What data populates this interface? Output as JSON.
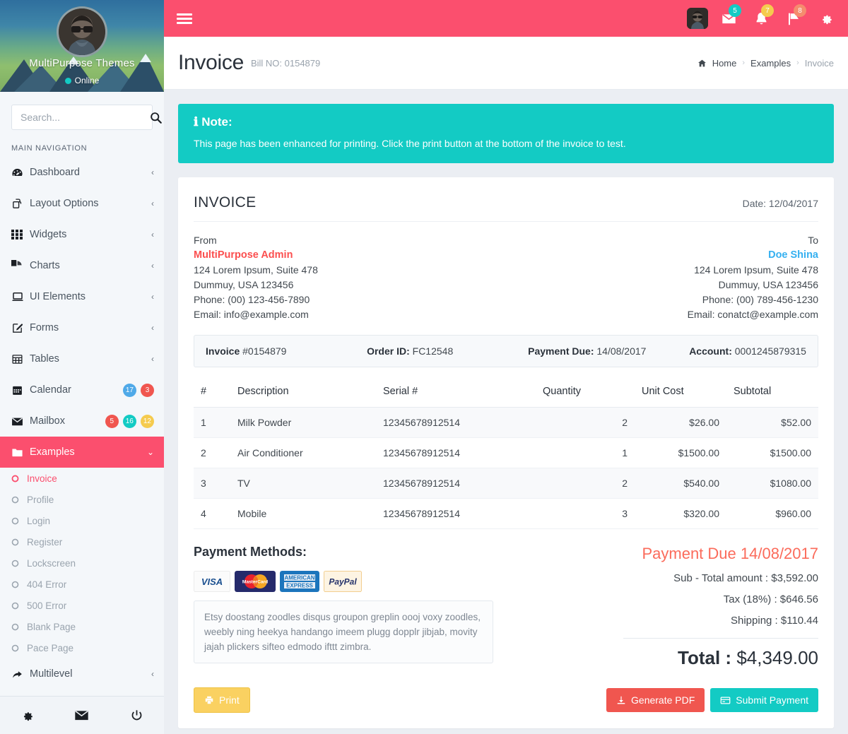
{
  "colors": {
    "brand_pink": "#fb4f6e",
    "teal": "#13cbc4",
    "yellow": "#fad161",
    "red": "#f0564f",
    "blue": "#35b0f0",
    "body_bg": "#ebeef3"
  },
  "sidebar": {
    "profile": {
      "name": "MultiPurpose Themes",
      "status": "Online",
      "avatar_icon": "user-avatar"
    },
    "search": {
      "placeholder": "Search...",
      "value": "",
      "icon": "search-icon"
    },
    "nav_title": "MAIN NAVIGATION",
    "items": [
      {
        "label": "Dashboard",
        "icon": "dashboard-icon",
        "caret": "‹",
        "badges": []
      },
      {
        "label": "Layout Options",
        "icon": "layers-icon",
        "caret": "‹",
        "badges": []
      },
      {
        "label": "Widgets",
        "icon": "grid-icon",
        "caret": "‹",
        "badges": []
      },
      {
        "label": "Charts",
        "icon": "pie-chart-icon",
        "caret": "‹",
        "badges": []
      },
      {
        "label": "UI Elements",
        "icon": "laptop-icon",
        "caret": "‹",
        "badges": []
      },
      {
        "label": "Forms",
        "icon": "edit-icon",
        "caret": "‹",
        "badges": []
      },
      {
        "label": "Tables",
        "icon": "table-icon",
        "caret": "‹",
        "badges": []
      },
      {
        "label": "Calendar",
        "icon": "calendar-icon",
        "caret": "",
        "badges": [
          {
            "text": "17",
            "color": "#4fa9e8"
          },
          {
            "text": "3",
            "color": "#f0564f"
          }
        ]
      },
      {
        "label": "Mailbox",
        "icon": "envelope-icon",
        "caret": "",
        "badges": [
          {
            "text": "5",
            "color": "#f0564f"
          },
          {
            "text": "16",
            "color": "#13cbc4"
          },
          {
            "text": "12",
            "color": "#f5cb4e"
          }
        ]
      }
    ],
    "examples": {
      "label": "Examples",
      "icon": "folder-icon",
      "caret": "⌄",
      "active": true,
      "children": [
        {
          "label": "Invoice",
          "active": true
        },
        {
          "label": "Profile",
          "active": false
        },
        {
          "label": "Login",
          "active": false
        },
        {
          "label": "Register",
          "active": false
        },
        {
          "label": "Lockscreen",
          "active": false
        },
        {
          "label": "404 Error",
          "active": false
        },
        {
          "label": "500 Error",
          "active": false
        },
        {
          "label": "Blank Page",
          "active": false
        },
        {
          "label": "Pace Page",
          "active": false
        }
      ]
    },
    "multilevel": {
      "label": "Multilevel",
      "icon": "share-arrow-icon",
      "caret": "‹"
    },
    "footer_icons": [
      {
        "name": "gear-icon"
      },
      {
        "name": "envelope-icon"
      },
      {
        "name": "power-icon"
      }
    ]
  },
  "topbar": {
    "menu_toggle_icon": "hamburger-icon",
    "avatar_icon": "user-avatar",
    "icons": [
      {
        "name": "envelope-icon",
        "badge": "5",
        "badge_color": "#13cbc4"
      },
      {
        "name": "bell-icon",
        "badge": "7",
        "badge_color": "#f5cb4e"
      },
      {
        "name": "flag-icon",
        "badge": "8",
        "badge_color": "#f58c6e"
      },
      {
        "name": "gear-icon",
        "badge": "",
        "badge_color": ""
      }
    ]
  },
  "pagehead": {
    "title": "Invoice",
    "subtitle": "Bill NO: 0154879",
    "breadcrumb": [
      {
        "label": "Home",
        "icon": "home-icon",
        "link": true
      },
      {
        "label": "Examples",
        "icon": "",
        "link": true
      },
      {
        "label": "Invoice",
        "icon": "",
        "link": false
      }
    ],
    "separator": "›"
  },
  "note": {
    "icon": "info-icon",
    "title": "Note:",
    "text": "This page has been enhanced for printing. Click the print button at the bottom of the invoice to test."
  },
  "invoice": {
    "heading": "INVOICE",
    "date_label": "Date: 12/04/2017",
    "from": {
      "tag": "From",
      "who": "MultiPurpose Admin",
      "address1": "124 Lorem Ipsum, Suite 478",
      "address2": "Dummuy, USA 123456",
      "phone": "Phone: (00) 123-456-7890",
      "email": "Email: info@example.com"
    },
    "to": {
      "tag": "To",
      "who": "Doe Shina",
      "address1": "124 Lorem Ipsum, Suite 478",
      "address2": "Dummuy, USA 123456",
      "phone": "Phone: (00) 789-456-1230",
      "email": "Email: conatct@example.com"
    },
    "meta": [
      {
        "label": "Invoice",
        "value": "#0154879"
      },
      {
        "label": "Order ID:",
        "value": "FC12548"
      },
      {
        "label": "Payment Due:",
        "value": "14/08/2017"
      },
      {
        "label": "Account:",
        "value": "0001245879315"
      }
    ],
    "table": {
      "headers": [
        "#",
        "Description",
        "Serial #",
        "Quantity",
        "Unit Cost",
        "Subtotal"
      ],
      "rows": [
        {
          "num": "1",
          "description": "Milk Powder",
          "serial": "12345678912514",
          "qty": "2",
          "unit": "$26.00",
          "subtotal": "$52.00"
        },
        {
          "num": "2",
          "description": "Air Conditioner",
          "serial": "12345678912514",
          "qty": "1",
          "unit": "$1500.00",
          "subtotal": "$1500.00"
        },
        {
          "num": "3",
          "description": "TV",
          "serial": "12345678912514",
          "qty": "2",
          "unit": "$540.00",
          "subtotal": "$1080.00"
        },
        {
          "num": "4",
          "description": "Mobile",
          "serial": "12345678912514",
          "qty": "3",
          "unit": "$320.00",
          "subtotal": "$960.00"
        }
      ]
    },
    "payment_methods": {
      "title": "Payment Methods:",
      "cards": [
        "visa-card-icon",
        "mastercard-card-icon",
        "amex-card-icon",
        "paypal-card-icon"
      ],
      "memo": "Etsy doostang zoodles disqus groupon greplin oooj voxy zoodles, weebly ning heekya handango imeem plugg dopplr jibjab, movity jajah plickers sifteo edmodo ifttt zimbra."
    },
    "totals": {
      "due_label": "Payment Due",
      "due_date": "14/08/2017",
      "lines": [
        "Sub - Total amount : $3,592.00",
        "Tax (18%) : $646.56",
        "Shipping : $110.44"
      ],
      "total_label": "Total :",
      "total_value": "$4,349.00"
    },
    "buttons": {
      "print": {
        "label": "Print",
        "icon": "printer-icon"
      },
      "pdf": {
        "label": "Generate PDF",
        "icon": "download-icon"
      },
      "submit": {
        "label": "Submit Payment",
        "icon": "credit-card-icon"
      }
    }
  }
}
